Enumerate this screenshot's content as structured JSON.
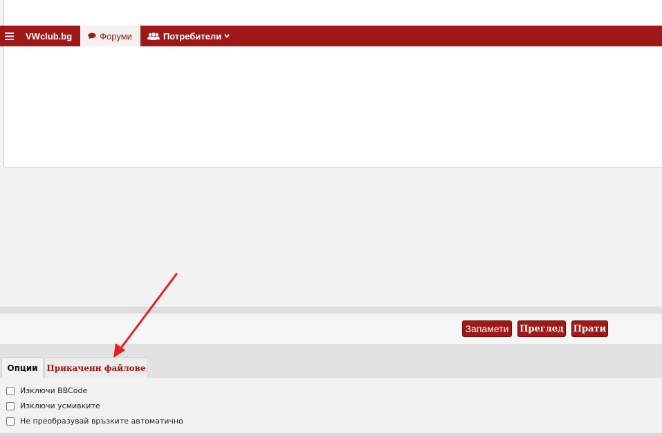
{
  "navbar": {
    "menu_icon": "hamburger-icon",
    "brand": "VWclub.bg",
    "forums": {
      "label": "Форуми",
      "icon": "comment-icon"
    },
    "users": {
      "label": "Потребители",
      "icon": "users-icon",
      "caret": "chevron-down-icon"
    },
    "color": "#a01818"
  },
  "actions": {
    "save": "Запамети",
    "preview": "Преглед",
    "submit": "Прати"
  },
  "tabs": [
    {
      "label": "Опции",
      "active": true
    },
    {
      "label": "Прикачени файлове",
      "active": false
    }
  ],
  "options": [
    {
      "label": "Изключи BBCode",
      "checked": false
    },
    {
      "label": "Изключи усмивките",
      "checked": false
    },
    {
      "label": "Не преобразувай връзките автоматично",
      "checked": false
    }
  ],
  "annotation": {
    "icon": "red-arrow-icon",
    "color": "#ee1c1c"
  }
}
